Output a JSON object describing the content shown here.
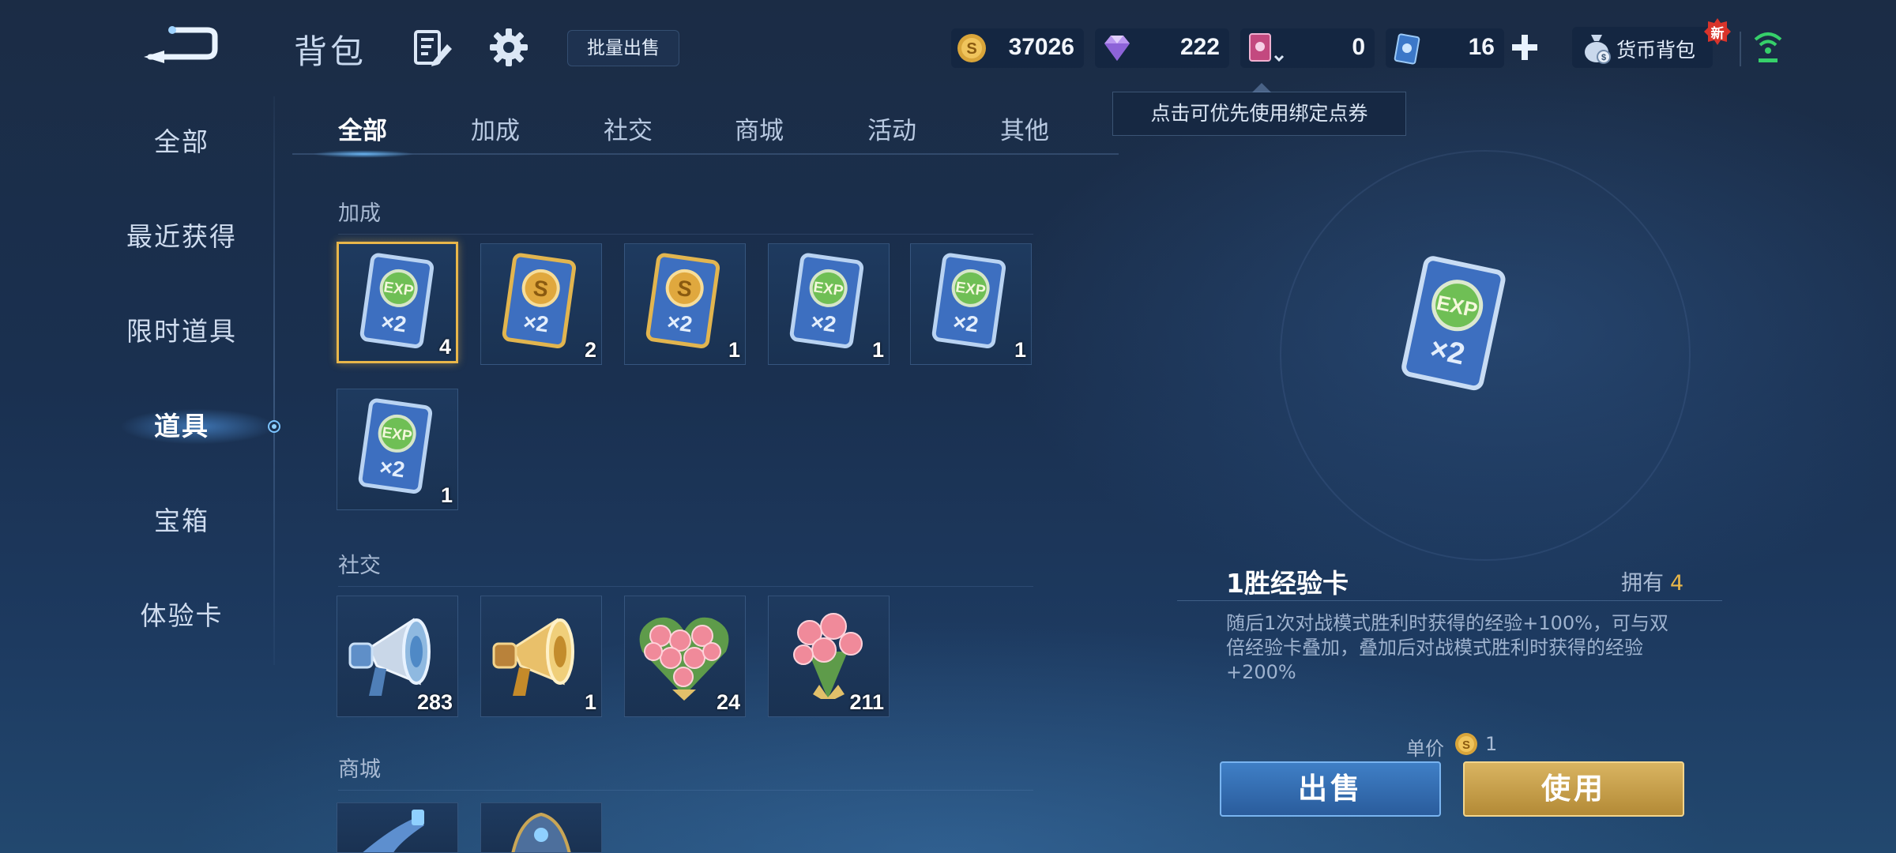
{
  "header": {
    "title": "背包",
    "batch_sell_label": "批量出售",
    "currencies": {
      "gold": "37026",
      "diamond": "222",
      "voucher": "0",
      "coupon": "16"
    },
    "wallet_label": "货币背包",
    "new_badge": "新",
    "tooltip": "点击可优先使用绑定点券"
  },
  "sidebar": {
    "items": [
      {
        "label": "全部"
      },
      {
        "label": "最近获得"
      },
      {
        "label": "限时道具"
      },
      {
        "label": "道具",
        "active": true
      },
      {
        "label": "宝箱"
      },
      {
        "label": "体验卡"
      }
    ]
  },
  "tabs": [
    {
      "label": "全部",
      "active": true
    },
    {
      "label": "加成"
    },
    {
      "label": "社交"
    },
    {
      "label": "商城"
    },
    {
      "label": "活动"
    },
    {
      "label": "其他"
    }
  ],
  "sections": {
    "bonus": {
      "title": "加成",
      "items": [
        {
          "icon": "exp-card-icon",
          "qty": "4",
          "selected": true
        },
        {
          "icon": "gold-card-icon",
          "qty": "2"
        },
        {
          "icon": "gold-card-icon",
          "qty": "1"
        },
        {
          "icon": "exp-card-icon",
          "qty": "1"
        },
        {
          "icon": "exp-card-icon",
          "qty": "1"
        },
        {
          "icon": "exp-card-icon",
          "qty": "1"
        }
      ]
    },
    "social": {
      "title": "社交",
      "items": [
        {
          "icon": "silver-megaphone-icon",
          "qty": "283"
        },
        {
          "icon": "gold-megaphone-icon",
          "qty": "1"
        },
        {
          "icon": "rose-heart-bouquet-icon",
          "qty": "24"
        },
        {
          "icon": "rose-bouquet-icon",
          "qty": "211"
        }
      ]
    },
    "mall": {
      "title": "商城"
    }
  },
  "card_text": {
    "exp": "EXP",
    "multiplier": "×2",
    "gold_symbol": "S"
  },
  "detail": {
    "name": "1胜经验卡",
    "own_label": "拥有",
    "own_value": "4",
    "description": "随后1次对战模式胜利时获得的经验+100%，可与双倍经验卡叠加，叠加后对战模式胜利时获得的经验+200%",
    "price_label": "单价",
    "price_value": "1",
    "sell_label": "出售",
    "use_label": "使用"
  },
  "colors": {
    "accent_gold": "#e8b64a",
    "sell_blue": "#3f7fc6",
    "use_gold": "#d9b461",
    "background": "#1a3050"
  }
}
